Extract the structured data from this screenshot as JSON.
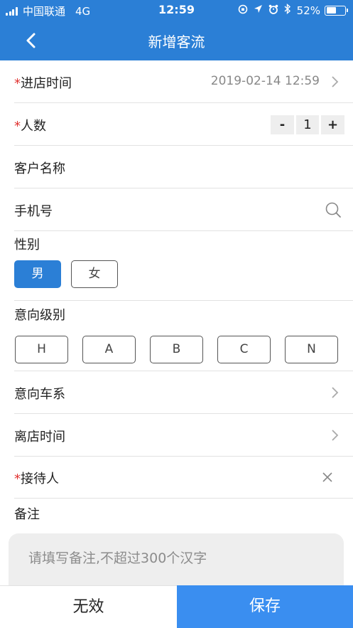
{
  "status_bar": {
    "carrier": "中国联通",
    "network": "4G",
    "time": "12:59",
    "battery": "52%",
    "battery_level": 0.52
  },
  "nav": {
    "title": "新增客流"
  },
  "form": {
    "required_mark": "*",
    "arrival_time": {
      "label": "进店时间",
      "value": "2019-02-14 12:59"
    },
    "people_count": {
      "label": "人数",
      "minus": "-",
      "value": "1",
      "plus": "+"
    },
    "customer_name": {
      "label": "客户名称"
    },
    "phone": {
      "label": "手机号"
    },
    "gender": {
      "label": "性别",
      "options": [
        "男",
        "女"
      ],
      "selected": "男"
    },
    "intent_level": {
      "label": "意向级别",
      "options": [
        "H",
        "A",
        "B",
        "C",
        "N"
      ]
    },
    "intent_series": {
      "label": "意向车系"
    },
    "departure_time": {
      "label": "离店时间"
    },
    "receptionist": {
      "label": "接待人"
    },
    "remark": {
      "label": "备注",
      "placeholder": "请填写备注,不超过300个汉字"
    }
  },
  "footer": {
    "invalid_label": "无效",
    "save_label": "保存"
  },
  "colors": {
    "primary": "#2b7fd6",
    "save": "#3a8ef0",
    "required": "#e0312f"
  }
}
